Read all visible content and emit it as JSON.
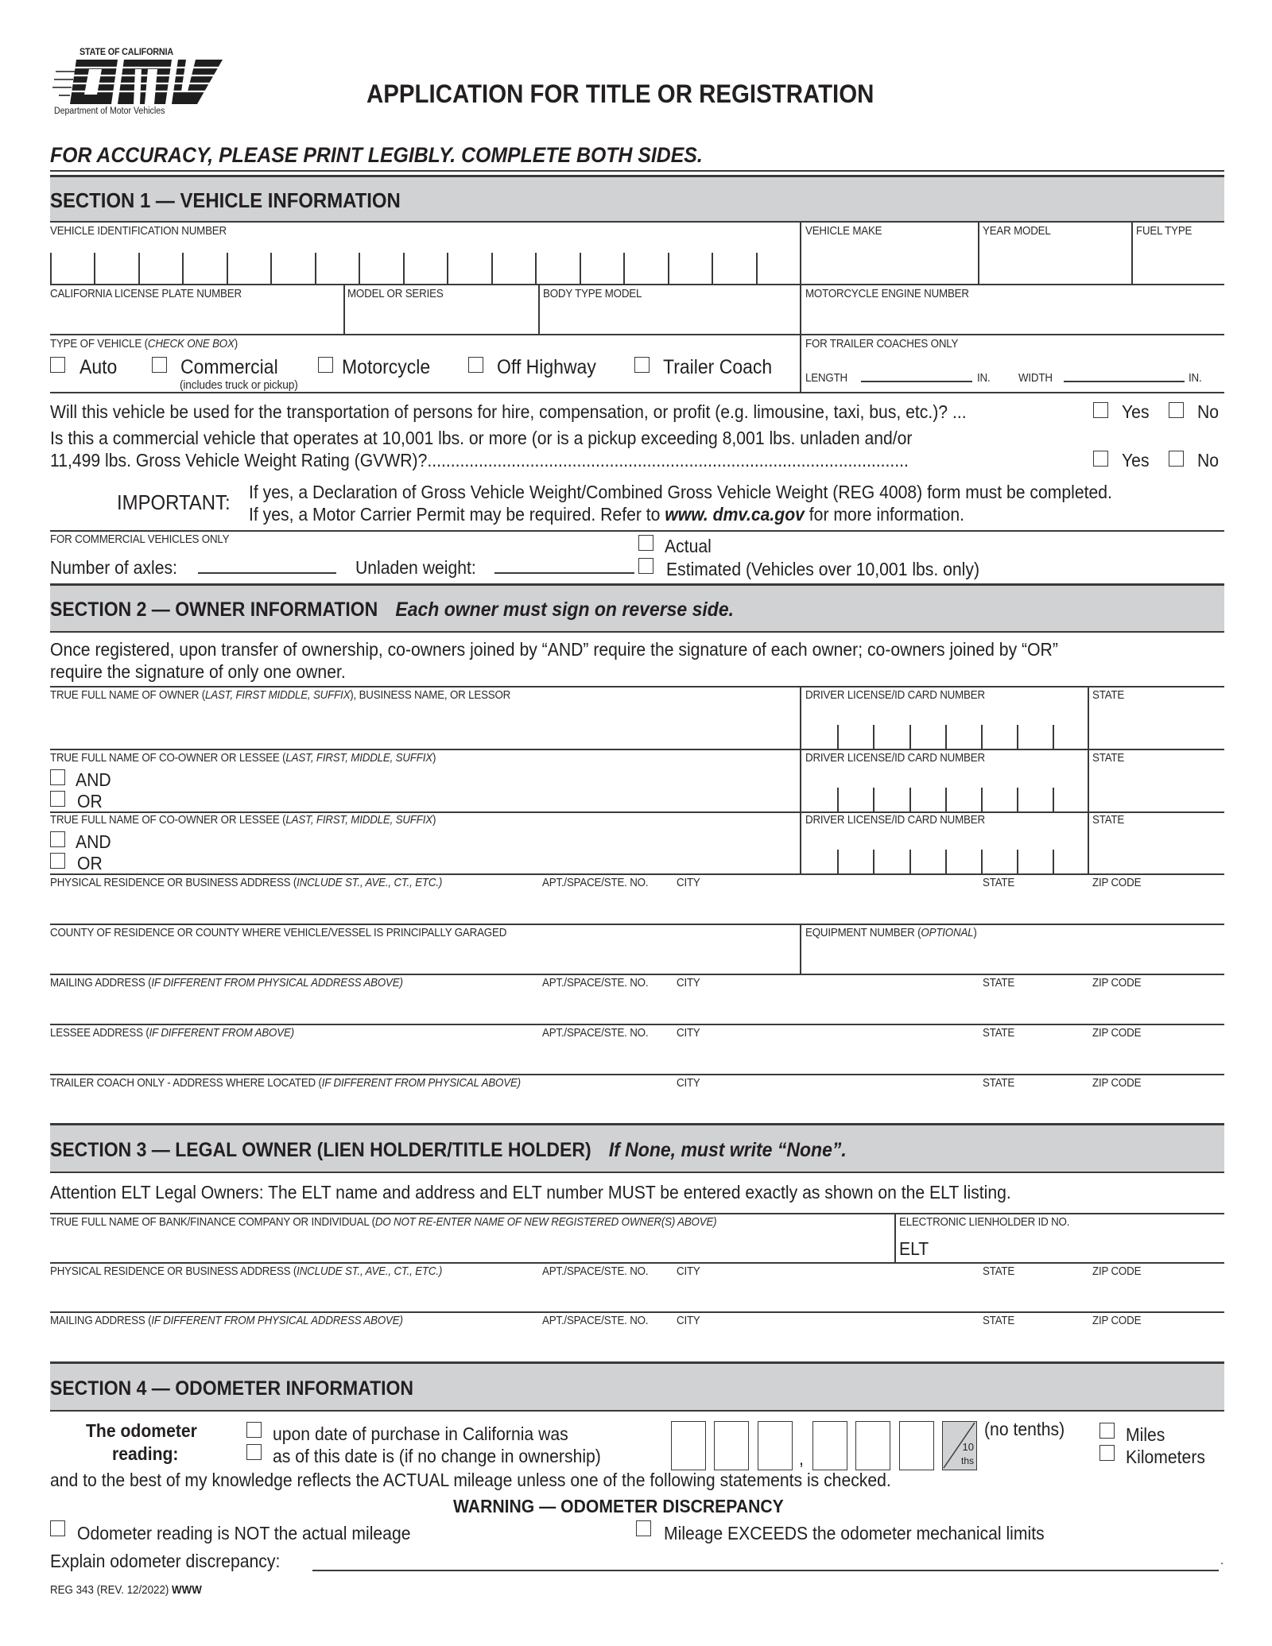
{
  "header": {
    "logo_state": "STATE OF CALIFORNIA",
    "logo_mark": "DMV",
    "logo_dept": "Department of Motor Vehicles",
    "title": "APPLICATION FOR TITLE OR REGISTRATION",
    "tagline": "FOR ACCURACY, PLEASE PRINT LEGIBLY. COMPLETE BOTH SIDES."
  },
  "section1": {
    "title": "SECTION 1 — VEHICLE INFORMATION",
    "vin_label": "VEHICLE IDENTIFICATION NUMBER",
    "vin_boxes": 17,
    "make_label": "VEHICLE MAKE",
    "year_label": "YEAR MODEL",
    "fuel_label": "FUEL TYPE",
    "plate_label": "CALIFORNIA LICENSE PLATE NUMBER",
    "model_label": "MODEL OR SERIES",
    "body_label": "BODY TYPE MODEL",
    "engine_label": "MOTORCYCLE ENGINE NUMBER",
    "type_label": "TYPE OF VEHICLE (",
    "type_label_italic": "CHECK ONE BOX",
    "type_label_end": ")",
    "vehicle_types": [
      {
        "label": "Auto",
        "checked": false
      },
      {
        "label": "Commercial",
        "note": "(includes truck or pickup)",
        "checked": false
      },
      {
        "label": "Motorcycle",
        "checked": false
      },
      {
        "label": "Off Highway",
        "checked": false
      },
      {
        "label": "Trailer Coach",
        "checked": false
      }
    ],
    "trailer_label": "FOR TRAILER COACHES ONLY",
    "length_label": "LENGTH",
    "width_label": "WIDTH",
    "in_unit": "IN.",
    "q1": "Will this vehicle be used for the transportation of persons for hire, compensation, or profit (e.g. limousine, taxi, bus, etc.)? ...",
    "q2_line1": "Is this a commercial vehicle that operates at 10,001 lbs. or more (or is a pickup exceeding 8,001 lbs. unladen and/or",
    "q2_line2": "11,499 lbs. Gross Vehicle Weight Rating (GVWR)?.......................................................................................................",
    "yes_label": "Yes",
    "no_label": "No",
    "important_label": "IMPORTANT:",
    "important_line1": "If yes, a Declaration of Gross Vehicle Weight/Combined Gross Vehicle Weight (REG 4008) form must be completed.",
    "important_line2_pre": "If yes, a Motor Carrier Permit may be required. Refer to ",
    "important_line2_link": "www. dmv.ca.gov",
    "important_line2_post": " for more information.",
    "commercial_label": "FOR COMMERCIAL VEHICLES ONLY",
    "axles_label": "Number of axles:",
    "unladen_label": "Unladen weight:",
    "actual_label": "Actual",
    "estimated_label": "Estimated (Vehicles over 10,001 lbs. only)"
  },
  "section2": {
    "title": "SECTION 2 — OWNER INFORMATION",
    "subtitle": "Each owner must sign on reverse side.",
    "intro_line1": "Once registered, upon transfer of ownership, co-owners joined by “AND” require the signature of each owner; co-owners joined by “OR”",
    "intro_line2": "require the signature of only one owner.",
    "owner_label_pre": "TRUE FULL NAME OF OWNER (",
    "owner_label_italic": "LAST, FIRST MIDDLE, SUFFIX",
    "owner_label_post": "), BUSINESS NAME, OR LESSOR",
    "coowner_label_pre": "TRUE FULL NAME OF CO-OWNER OR LESSEE (",
    "coowner_label_italic": "LAST, FIRST, MIDDLE, SUFFIX",
    "coowner_label_post": ")",
    "and_label": "AND",
    "or_label": "OR",
    "dl_label": "DRIVER LICENSE/ID CARD NUMBER",
    "dl_boxes": 8,
    "state_label": "STATE",
    "phys_label_pre": "PHYSICAL RESIDENCE OR BUSINESS ADDRESS (",
    "phys_label_italic": "INCLUDE ST., AVE., CT., ETC.)",
    "apt_label": "APT./SPACE/STE. NO.",
    "city_label": "CITY",
    "zip_label": "ZIP CODE",
    "county_label": "COUNTY OF RESIDENCE OR COUNTY WHERE VEHICLE/VESSEL IS PRINCIPALLY GARAGED",
    "equipment_label_pre": "EQUIPMENT NUMBER (",
    "equipment_label_italic": "OPTIONAL",
    "equipment_label_post": ")",
    "mailing_label_pre": "MAILING ADDRESS (",
    "mailing_label_italic": "IF DIFFERENT FROM PHYSICAL ADDRESS ABOVE)",
    "lessee_label_pre": "LESSEE ADDRESS (",
    "lessee_label_italic": "IF DIFFERENT FROM ABOVE)",
    "trailer_addr_label_pre": "TRAILER COACH ONLY - ADDRESS WHERE LOCATED (",
    "trailer_addr_label_italic": "IF DIFFERENT FROM PHYSICAL ABOVE)"
  },
  "section3": {
    "title": "SECTION 3 — LEGAL OWNER (LIEN HOLDER/TITLE HOLDER)",
    "subtitle": "If None, must write “None”.",
    "attention": "Attention ELT Legal Owners: The ELT name and address and ELT number MUST be entered exactly as shown on the ELT listing.",
    "bank_label_pre": "TRUE FULL NAME OF BANK/FINANCE COMPANY OR INDIVIDUAL (",
    "bank_label_italic": "DO NOT RE-ENTER NAME OF NEW REGISTERED OWNER(S) ABOVE)",
    "elt_label": "ELECTRONIC LIENHOLDER ID NO.",
    "elt_prefix": "ELT"
  },
  "section4": {
    "title": "SECTION 4 — ODOMETER INFORMATION",
    "reading_label_1": "The odometer",
    "reading_label_2": "reading:",
    "opt_purchase": "upon date of purchase in California was",
    "opt_asof": "as of this date is (if no change in ownership)",
    "comma": ",",
    "tenths_top": "10",
    "tenths_bottom": "ths",
    "no_tenths": "(no tenths)",
    "miles_label": "Miles",
    "km_label": "Kilometers",
    "statement": "and to the best of my knowledge reflects the ACTUAL mileage unless one of the following statements is checked.",
    "warning": "WARNING — ODOMETER DISCREPANCY",
    "not_actual": "Odometer reading is NOT the actual mileage",
    "exceeds": "Mileage EXCEEDS the odometer mechanical limits",
    "explain_label": "Explain odometer discrepancy:",
    "explain_end": "."
  },
  "footer": {
    "form_id": "REG 343 (REV. 12/2022)",
    "form_suffix": "WWW"
  }
}
